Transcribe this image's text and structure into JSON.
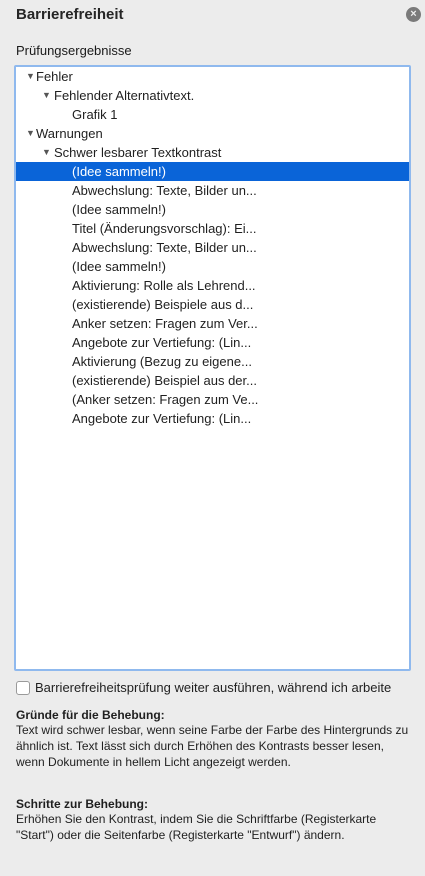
{
  "panel": {
    "title": "Barrierefreiheit",
    "close_icon": "×",
    "results_label": "Prüfungsergebnisse"
  },
  "tree": {
    "rows": [
      {
        "label": "Fehler",
        "expanded": true
      },
      {
        "label": "Fehlender Alternativtext.",
        "expanded": true
      },
      {
        "label": "Grafik 1"
      },
      {
        "label": "Warnungen",
        "expanded": true
      },
      {
        "label": "Schwer lesbarer Textkontrast",
        "expanded": true
      },
      {
        "label": "(Idee sammeln!)",
        "selected": true
      },
      {
        "label": "Abwechslung: Texte, Bilder un..."
      },
      {
        "label": "(Idee sammeln!)"
      },
      {
        "label": "Titel (Änderungsvorschlag): Ei..."
      },
      {
        "label": "Abwechslung: Texte, Bilder un..."
      },
      {
        "label": "(Idee sammeln!)"
      },
      {
        "label": "Aktivierung: Rolle als Lehrend..."
      },
      {
        "label": "(existierende) Beispiele aus d..."
      },
      {
        "label": "Anker setzen: Fragen zum Ver..."
      },
      {
        "label": "Angebote zur Vertiefung: (Lin..."
      },
      {
        "label": "Aktivierung (Bezug zu eigene..."
      },
      {
        "label": "(existierende) Beispiel aus der..."
      },
      {
        "label": "(Anker setzen: Fragen zum Ve..."
      },
      {
        "label": "Angebote zur Vertiefung: (Lin..."
      }
    ],
    "expand_icon": "▼"
  },
  "option": {
    "checked": false,
    "label": "Barrierefreiheitsprüfung weiter ausführen, während ich arbeite"
  },
  "reasons": {
    "heading": "Gründe für die Behebung:",
    "text": "Text wird schwer lesbar, wenn seine Farbe der Farbe des Hintergrunds zu ähnlich ist. Text lässt sich durch Erhöhen des Kontrasts besser lesen, wenn Dokumente in hellem Licht angezeigt werden."
  },
  "steps": {
    "heading": "Schritte zur Behebung:",
    "text": "Erhöhen Sie den Kontrast, indem Sie die Schriftfarbe (Registerkarte \"Start\") oder die Seitenfarbe (Registerkarte \"Entwurf\") ändern."
  },
  "colors": {
    "selection": "#0a64d8",
    "focus_ring": "#8fb9ee",
    "panel_bg": "#ececec"
  }
}
